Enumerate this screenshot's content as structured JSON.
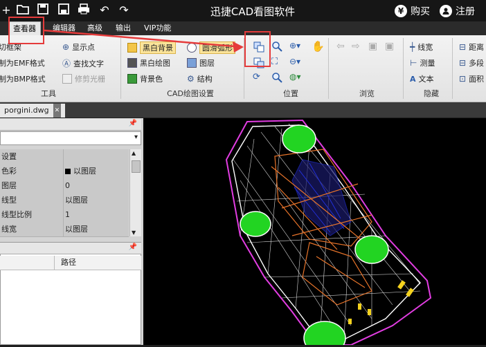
{
  "titlebar": {
    "app_title": "迅捷CAD看图软件",
    "buy_label": "购买",
    "register_label": "注册",
    "buy_icon_glyph": "¥",
    "register_icon_glyph": "●"
  },
  "menu": {
    "tabs": [
      "查看器",
      "编辑器",
      "高级",
      "输出",
      "VIP功能"
    ],
    "active_tab": "查看器"
  },
  "ribbon": {
    "tools_group": {
      "label": "工具",
      "items": [
        "切框架",
        "制为EMF格式",
        "制为BMP格式"
      ],
      "items2": [
        "显示点",
        "查找文字",
        "修剪光栅"
      ]
    },
    "cad_group": {
      "label": "CAD绘图设置",
      "items": [
        "黑白背景",
        "黑白绘图",
        "背景色"
      ],
      "items2": [
        "圆滑弧形",
        "图层",
        "结构"
      ]
    },
    "position_group": {
      "label": "位置"
    },
    "browse_group": {
      "label": "浏览"
    },
    "hide_group": {
      "label": "隐藏",
      "items": [
        "线宽",
        "测量",
        "文本"
      ]
    },
    "extra_group": {
      "items": [
        "距离",
        "多段",
        "面积"
      ]
    }
  },
  "document": {
    "tab_label": "porgini.dwg",
    "close_glyph": "✕"
  },
  "properties": {
    "rows": [
      {
        "key": "设置",
        "value": ""
      },
      {
        "key": "色彩",
        "value": "以图层"
      },
      {
        "key": "图层",
        "value": "0"
      },
      {
        "key": "线型",
        "value": "以图层"
      },
      {
        "key": "线型比例",
        "value": "1"
      },
      {
        "key": "线宽",
        "value": "以图层"
      }
    ]
  },
  "filelist": {
    "column_path": "路径"
  },
  "colors": {
    "annotation": "#e53b3b",
    "wheel": "#22d422",
    "wire_white": "#ffffff",
    "wire_magenta": "#e23de2",
    "wire_orange": "#e8742a",
    "wire_blue": "#2230d8",
    "wire_yellow": "#f4d21e"
  }
}
